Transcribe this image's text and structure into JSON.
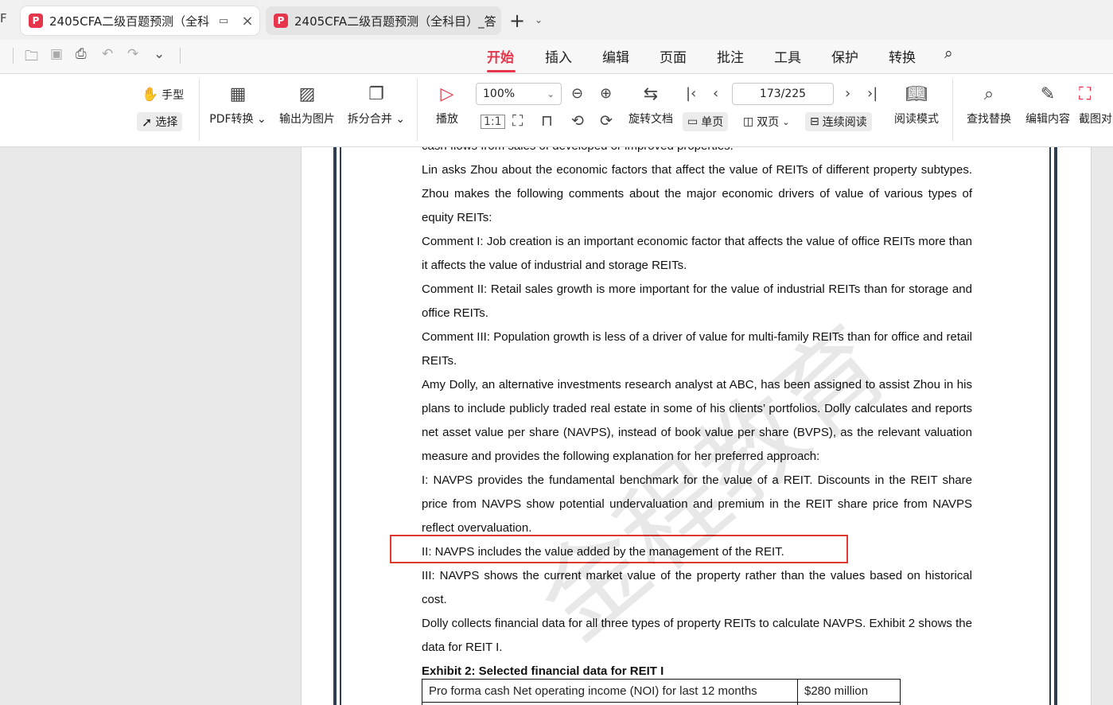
{
  "tabs": [
    {
      "label": "2405CFA二级百题预测（全科"
    },
    {
      "label": "2405CFA二级百题预测（全科目）_答"
    }
  ],
  "tab_edge": "F",
  "menu": [
    "开始",
    "插入",
    "编辑",
    "页面",
    "批注",
    "工具",
    "保护",
    "转换"
  ],
  "ribbon": {
    "hand": "手型",
    "select": "选择",
    "pdf_convert": "PDF转换",
    "export_image": "输出为图片",
    "split_merge": "拆分合并",
    "play": "播放",
    "zoom": "100%",
    "rotate_doc": "旋转文档",
    "single_page": "单页",
    "double_page": "双页",
    "continuous": "连续阅读",
    "reading_mode": "阅读模式",
    "page_indicator": "173/225",
    "find_replace": "查找替换",
    "edit_content": "编辑内容",
    "screenshot": "截图对"
  },
  "document": {
    "top_partial": "cash flows from sales of developed or improved properties.",
    "paragraphs": [
      "Lin asks Zhou about the economic factors that affect the value of REITs of different property subtypes. Zhou makes the following comments about the major economic drivers of value of various types of equity REITs:",
      "Comment I: Job creation is an important economic factor that affects the value of office REITs more than it affects the value of industrial and storage REITs.",
      "Comment II: Retail sales growth is more important for the value of industrial REITs than for storage and office REITs.",
      "Comment III: Population growth is less of a driver of value for multi-family REITs than for office and retail REITs.",
      "Amy Dolly, an alternative investments research analyst at ABC, has been assigned to assist Zhou in his plans to include publicly traded real estate in some of his clients’ portfolios. Dolly calculates and reports net asset value per share (NAVPS), instead of book value per share (BVPS), as the relevant valuation measure and provides the following explanation for her preferred approach:",
      "I: NAVPS provides the fundamental benchmark for the value of a REIT. Discounts in the REIT share price from NAVPS show potential undervaluation and premium in the REIT share price from NAVPS reflect overvaluation.",
      "II: NAVPS includes the value added by the management of the REIT.",
      "III: NAVPS shows the current market value of the property rather than the values based on historical cost.",
      "Dolly collects financial data for all three types of property REITs to calculate NAVPS. Exhibit 2 shows the data for REIT I."
    ],
    "exhibit_title": "Exhibit 2: Selected financial data for REIT I",
    "table": [
      {
        "label": "Pro forma cash Net operating income (NOI) for last 12 months",
        "value": "$280 million"
      },
      {
        "label": "",
        "value": ""
      }
    ],
    "watermark": "金程教育"
  }
}
